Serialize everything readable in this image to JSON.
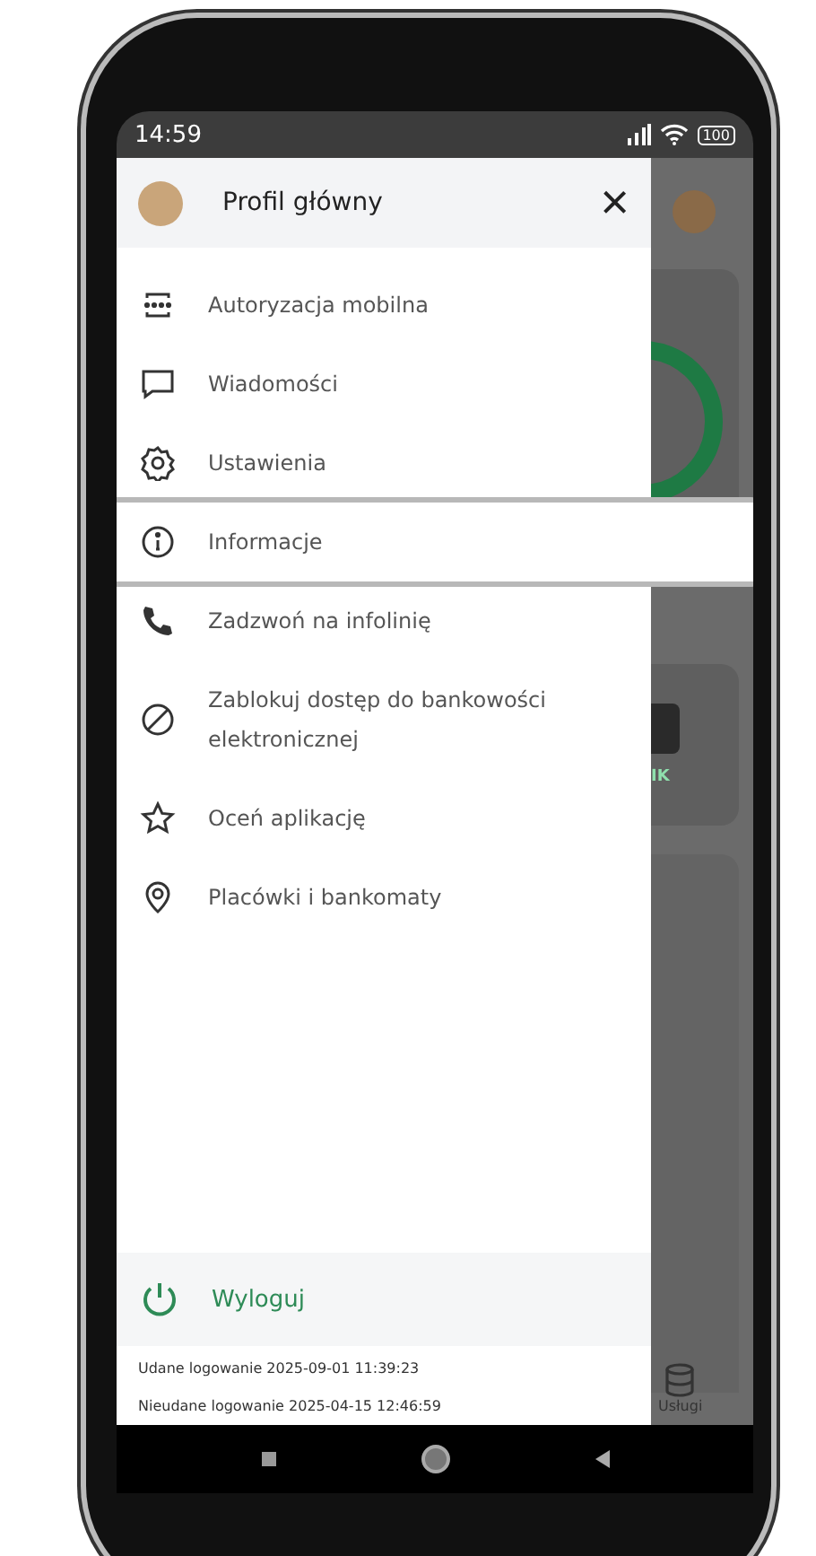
{
  "status_bar": {
    "time": "14:59",
    "battery": "100"
  },
  "drawer": {
    "title": "Profil główny",
    "close": "×",
    "items": [
      {
        "label": "Autoryzacja mobilna",
        "selected": false
      },
      {
        "label": "Wiadomości",
        "selected": false
      },
      {
        "label": "Ustawienia",
        "selected": false
      },
      {
        "label": "Informacje",
        "selected": true
      },
      {
        "label": "Zadzwoń na infolinię",
        "selected": false
      },
      {
        "label": "Zablokuj dostęp do bankowości elektronicznej",
        "selected": false
      },
      {
        "label": "Oceń aplikację",
        "selected": false
      },
      {
        "label": "Placówki i bankomaty",
        "selected": false
      }
    ],
    "logout": "Wyloguj",
    "login_info": [
      "Udane logowanie 2025-09-01 11:39:23",
      "Nieudane logowanie 2025-04-15 12:46:59"
    ]
  },
  "background_app": {
    "tile_label": "IK",
    "nav_label": "Usługi"
  }
}
